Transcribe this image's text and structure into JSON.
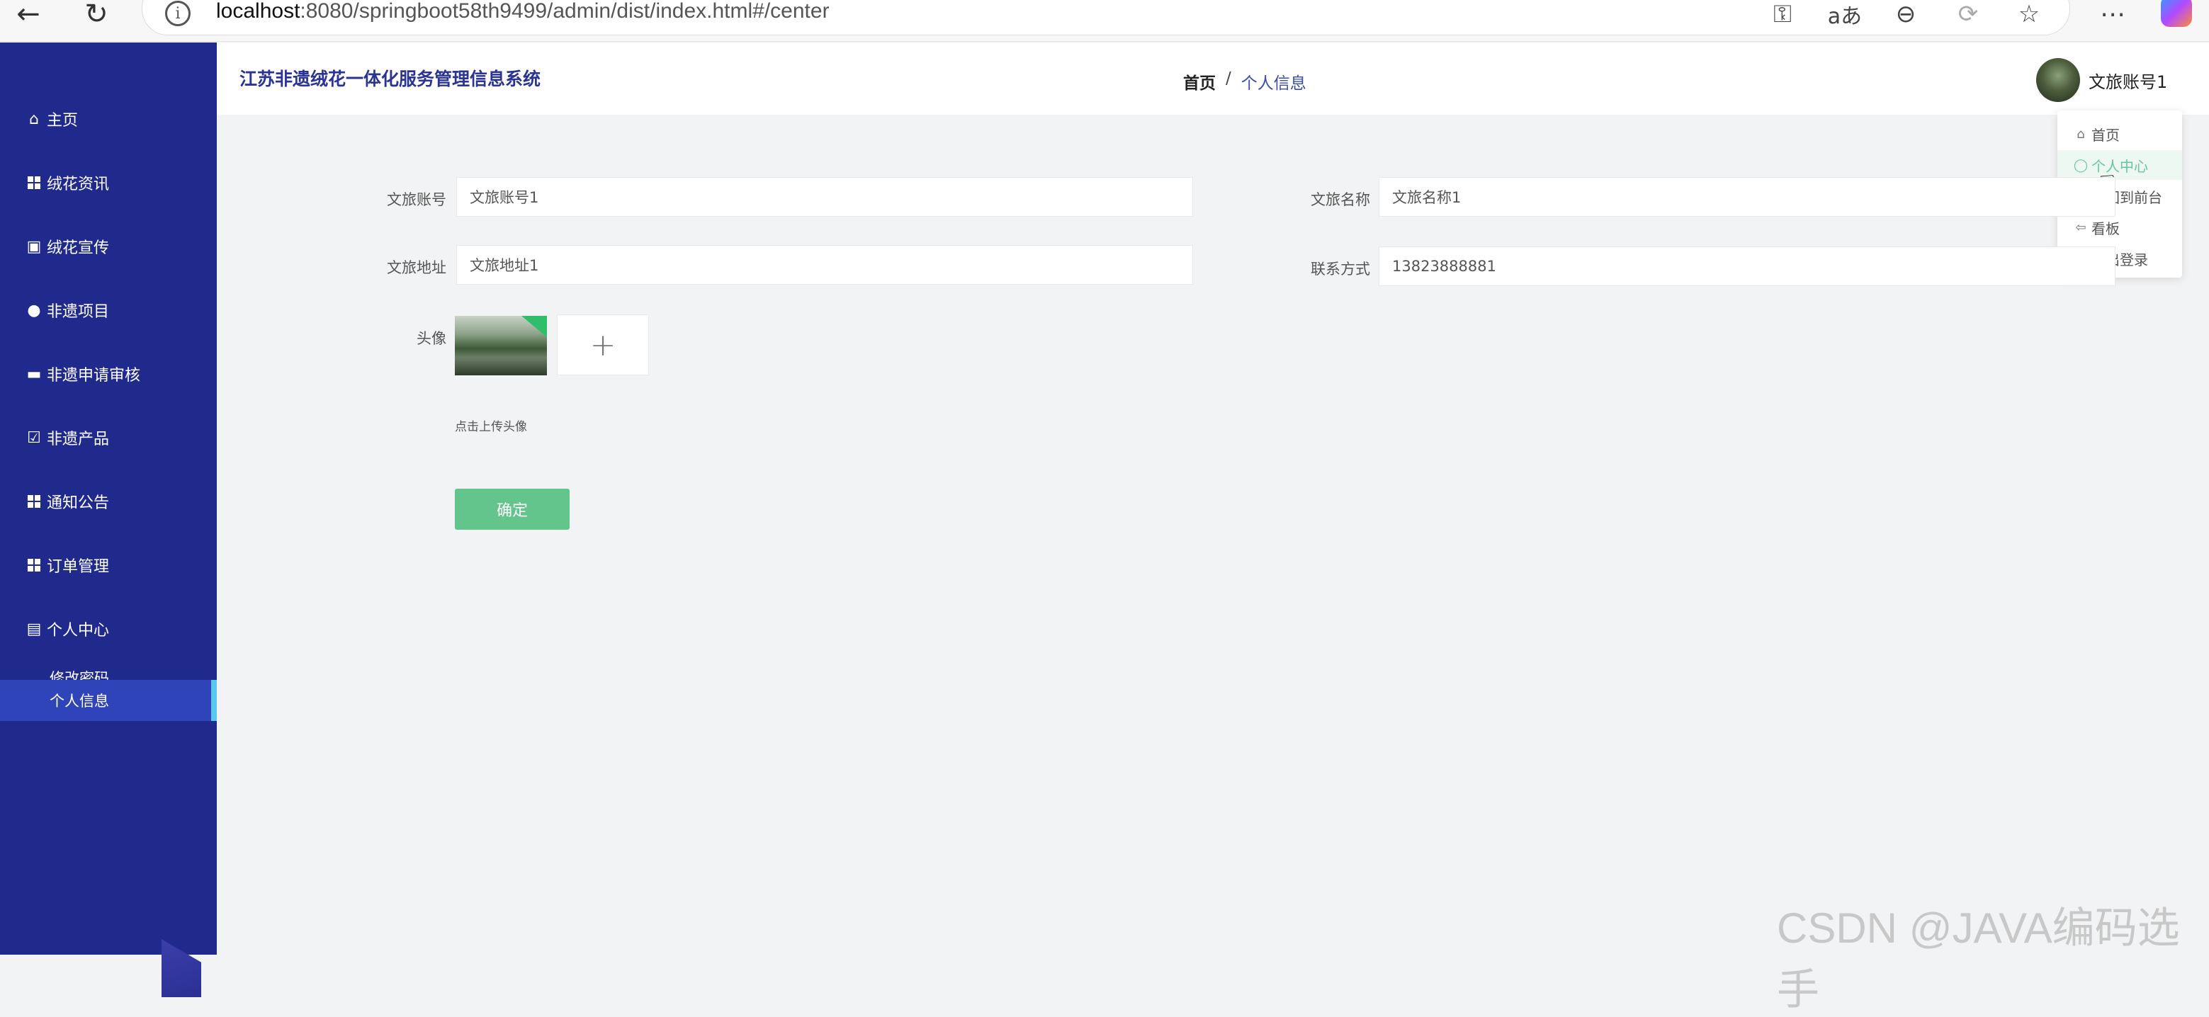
{
  "browser": {
    "url_host": "localhost",
    "url_rest": ":8080/springboot58th9499/admin/dist/index.html#/center",
    "read_aloud": "aあ"
  },
  "header": {
    "title": "江苏非遗绒花一体化服务管理信息系统",
    "breadcrumb_home": "首页",
    "breadcrumb_sep": "/",
    "breadcrumb_current": "个人信息",
    "username": "文旅账号1"
  },
  "sidebar": {
    "items": [
      {
        "label": "主页",
        "icon": "home-icon"
      },
      {
        "label": "绒花资讯",
        "icon": "grid-icon"
      },
      {
        "label": "绒花宣传",
        "icon": "briefcase-icon"
      },
      {
        "label": "非遗项目",
        "icon": "user-icon"
      },
      {
        "label": "非遗申请审核",
        "icon": "monitor-icon"
      },
      {
        "label": "非遗产品",
        "icon": "clipboard-icon"
      },
      {
        "label": "通知公告",
        "icon": "grid-icon"
      },
      {
        "label": "订单管理",
        "icon": "grid-icon"
      },
      {
        "label": "个人中心",
        "icon": "wallet-icon"
      }
    ],
    "sub_items": [
      {
        "label": "修改密码"
      },
      {
        "label": "个人信息",
        "active": true
      }
    ]
  },
  "dropdown": {
    "items": [
      {
        "label": "首页",
        "icon": "home-icon"
      },
      {
        "label": "个人中心",
        "icon": "user-icon"
      },
      {
        "label": "返回到前台",
        "icon": "back-icon"
      },
      {
        "label": "看板",
        "icon": "back-icon"
      },
      {
        "label": "退出登录",
        "icon": "logout-icon"
      }
    ]
  },
  "form": {
    "account_label": "文旅账号",
    "account_value": "文旅账号1",
    "name_label": "文旅名称",
    "name_value": "文旅名称1",
    "address_label": "文旅地址",
    "address_value": "文旅地址1",
    "contact_label": "联系方式",
    "contact_value": "13823888881",
    "avatar_label": "头像",
    "upload_plus": "+",
    "upload_hint": "点击上传头像",
    "confirm_label": "确定"
  },
  "watermark": "CSDN @JAVA编码选手",
  "colors": {
    "sidebar_bg": "#202a8c",
    "sidebar_active": "#2f44b8",
    "accent": "#63c58c",
    "title_color": "#2b3492"
  }
}
